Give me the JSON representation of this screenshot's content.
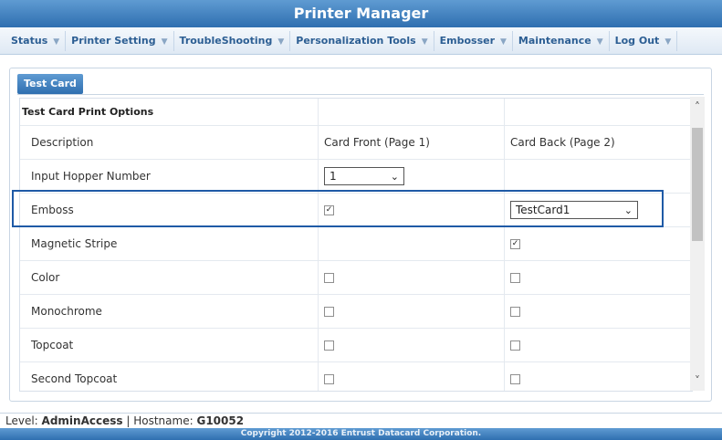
{
  "app": {
    "title": "Printer Manager"
  },
  "nav": [
    {
      "label": "Status"
    },
    {
      "label": "Printer Setting"
    },
    {
      "label": "TroubleShooting"
    },
    {
      "label": "Personalization Tools"
    },
    {
      "label": "Embosser"
    },
    {
      "label": "Maintenance"
    },
    {
      "label": "Log Out"
    }
  ],
  "panel": {
    "tab": "Test Card",
    "section_title": "Test Card Print Options",
    "columns": {
      "description": "Description",
      "front": "Card Front (Page 1)",
      "back": "Card Back (Page 2)"
    },
    "rows": [
      {
        "label": "Input Hopper Number",
        "front_select": "1"
      },
      {
        "label": "Emboss",
        "front_checked": true,
        "back_select": "TestCard1"
      },
      {
        "label": "Magnetic Stripe",
        "back_checked": true
      },
      {
        "label": "Color",
        "front_checked": false,
        "back_checked": false
      },
      {
        "label": "Monochrome",
        "front_checked": false,
        "back_checked": false
      },
      {
        "label": "Topcoat",
        "front_checked": false,
        "back_checked": false
      },
      {
        "label": "Second Topcoat",
        "front_checked": false,
        "back_checked": false
      }
    ]
  },
  "status": {
    "level_label": "Level:",
    "level_value": "AdminAccess",
    "separator": "|",
    "hostname_label": "Hostname:",
    "hostname_value": "G10052"
  },
  "footer": {
    "copyright": "Copyright 2012-2016 Entrust Datacard Corporation."
  },
  "colors": {
    "accent": "#2f6fb0",
    "highlight_border": "#1f5aa6"
  }
}
